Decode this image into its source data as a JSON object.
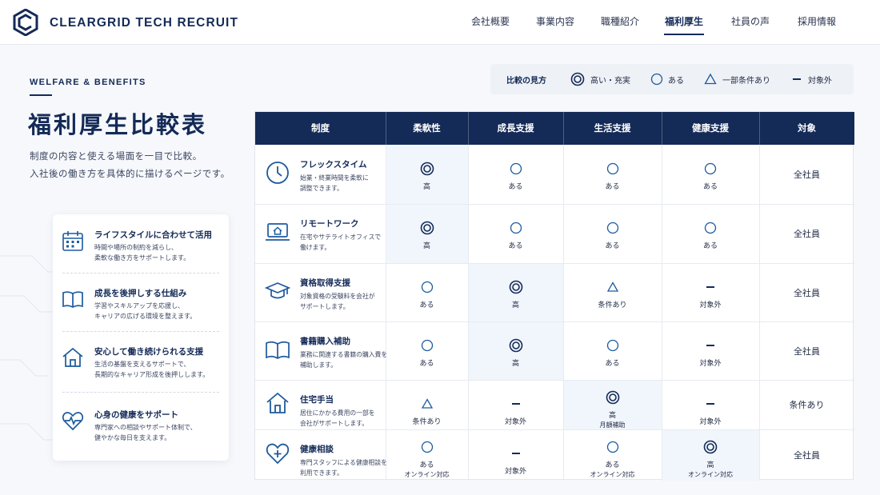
{
  "brand": {
    "name": "CLEARGRID TECH RECRUIT"
  },
  "nav": {
    "items": [
      {
        "label": "会社概要"
      },
      {
        "label": "事業内容"
      },
      {
        "label": "職種紹介"
      },
      {
        "label": "福利厚生"
      },
      {
        "label": "社員の声"
      },
      {
        "label": "採用情報"
      }
    ],
    "active": "福利厚生"
  },
  "hero": {
    "section_label": "WELFARE & BENEFITS",
    "title": "福利厚生比較表",
    "intro": [
      "制度の内容と使える場面を一目で比較。",
      "入社後の働き方を具体的に描けるページです。"
    ]
  },
  "features": [
    {
      "icon": "calendar-icon",
      "title": "ライフスタイルに合わせて活用",
      "desc": [
        "時間や場所の制約を減らし、",
        "柔軟な働き方をサポートします。"
      ]
    },
    {
      "icon": "book-icon",
      "title": "成長を後押しする仕組み",
      "desc": [
        "学習やスキルアップを応援し、",
        "キャリアの広げる環境を整えます。"
      ]
    },
    {
      "icon": "house-icon",
      "title": "安心して働き続けられる支援",
      "desc": [
        "生活の基盤を支えるサポートで、",
        "長期的なキャリア形成を後押しします。"
      ]
    },
    {
      "icon": "heart-pulse-icon",
      "title": "心身の健康をサポート",
      "desc": [
        "専門家への相談やサポート体制で、",
        "健やかな毎日を支えます。"
      ]
    }
  ],
  "legend": {
    "title": "比較の見方",
    "items": [
      {
        "symbol": "double-circle",
        "label": "高い・充実"
      },
      {
        "symbol": "circle",
        "label": "ある"
      },
      {
        "symbol": "triangle",
        "label": "一部条件あり"
      },
      {
        "symbol": "dash",
        "label": "対象外"
      }
    ]
  },
  "table": {
    "headers": [
      "制度",
      "柔軟性",
      "成長支援",
      "生活支援",
      "健康支援",
      "対象"
    ],
    "rows": [
      {
        "icon": "clock-icon",
        "name": "フレックスタイム",
        "desc": [
          "始業・終業時間を柔軟に",
          "調整できます。"
        ],
        "cells": [
          {
            "symbol": "double-circle",
            "text": "高",
            "sub": ""
          },
          {
            "symbol": "circle",
            "text": "ある",
            "sub": ""
          },
          {
            "symbol": "circle",
            "text": "ある",
            "sub": ""
          },
          {
            "symbol": "circle",
            "text": "ある",
            "sub": ""
          }
        ],
        "target": "全社員"
      },
      {
        "icon": "laptop-home-icon",
        "name": "リモートワーク",
        "desc": [
          "在宅やサテライトオフィスで",
          "働けます。"
        ],
        "cells": [
          {
            "symbol": "double-circle",
            "text": "高",
            "sub": ""
          },
          {
            "symbol": "circle",
            "text": "ある",
            "sub": ""
          },
          {
            "symbol": "circle",
            "text": "ある",
            "sub": ""
          },
          {
            "symbol": "circle",
            "text": "ある",
            "sub": ""
          }
        ],
        "target": "全社員"
      },
      {
        "icon": "graduation-cap-icon",
        "name": "資格取得支援",
        "desc": [
          "対象資格の受験料を会社が",
          "サポートします。"
        ],
        "cells": [
          {
            "symbol": "circle",
            "text": "ある",
            "sub": ""
          },
          {
            "symbol": "double-circle",
            "text": "高",
            "sub": ""
          },
          {
            "symbol": "triangle",
            "text": "条件あり",
            "sub": ""
          },
          {
            "symbol": "dash",
            "text": "対象外",
            "sub": ""
          }
        ],
        "target": "全社員"
      },
      {
        "icon": "open-book-icon",
        "name": "書籍購入補助",
        "desc": [
          "業務に関連する書籍の購入費を",
          "補助します。"
        ],
        "cells": [
          {
            "symbol": "circle",
            "text": "ある",
            "sub": ""
          },
          {
            "symbol": "double-circle",
            "text": "高",
            "sub": ""
          },
          {
            "symbol": "circle",
            "text": "ある",
            "sub": ""
          },
          {
            "symbol": "dash",
            "text": "対象外",
            "sub": ""
          }
        ],
        "target": "全社員"
      },
      {
        "icon": "house-icon",
        "name": "住宅手当",
        "desc": [
          "居住にかかる費用の一部を",
          "会社がサポートします。"
        ],
        "cells": [
          {
            "symbol": "triangle",
            "text": "条件あり",
            "sub": ""
          },
          {
            "symbol": "dash",
            "text": "対象外",
            "sub": ""
          },
          {
            "symbol": "double-circle",
            "text": "高",
            "sub": "月額補助"
          },
          {
            "symbol": "dash",
            "text": "対象外",
            "sub": ""
          }
        ],
        "target": "条件あり"
      },
      {
        "icon": "heart-plus-icon",
        "name": "健康相談",
        "desc": [
          "専門スタッフによる健康相談を",
          "利用できます。"
        ],
        "cells": [
          {
            "symbol": "circle",
            "text": "ある",
            "sub": "オンライン対応"
          },
          {
            "symbol": "dash",
            "text": "対象外",
            "sub": ""
          },
          {
            "symbol": "circle",
            "text": "ある",
            "sub": "オンライン対応"
          },
          {
            "symbol": "double-circle",
            "text": "高",
            "sub": "オンライン対応"
          }
        ],
        "target": "全社員"
      }
    ]
  },
  "colors": {
    "navy": "#142a57",
    "highlight": "#f1f6fc",
    "background": "#f6f8fb"
  }
}
